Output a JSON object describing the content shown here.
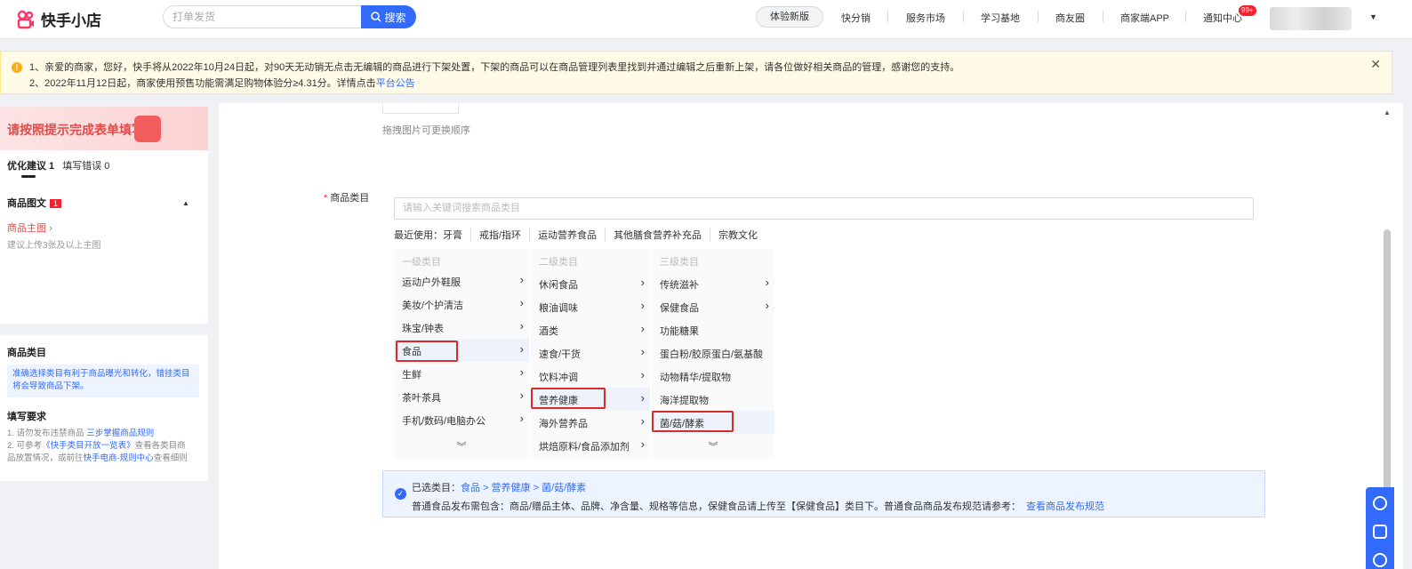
{
  "header": {
    "logo_text": "快手小店",
    "search_placeholder": "打单发货",
    "search_button": "搜索",
    "nav_pill": "体验新版",
    "nav_items": [
      "快分销",
      "服务市场",
      "学习基地",
      "商友圈",
      "商家端APP",
      "通知中心"
    ],
    "notify_badge": "99+",
    "caret": "▼"
  },
  "notice": {
    "line1": "1、亲爱的商家，您好，快手将从2022年10月24日起，对90天无动销无点击无编辑的商品进行下架处置，下架的商品可以在商品管理列表里找到并通过编辑之后重新上架，请各位做好相关商品的管理，感谢您的支持。",
    "line2_prefix": "2、2022年11月12日起，商家使用预售功能需满足购物体验分≥4.31分。详情点击",
    "line2_link": "平台公告",
    "close": "✕"
  },
  "sidebar": {
    "banner_text": "请按照提示完成表单填写",
    "tab_optimize": "优化建议 1",
    "tab_errors": "填写错误 0",
    "section_title": "商品图文",
    "section_count": "1",
    "link_main_image": "商品主图",
    "hint_main_image": "建议上传3张及以上主图",
    "cat_title": "商品类目",
    "cat_info": "准确选择类目有利于商品曝光和转化，错挂类目将会导致商品下架。",
    "req_title": "填写要求",
    "req_line1_prefix": "1. 请勿发布违禁商品",
    "req_line1_link": "三步掌握商品规则",
    "req_line2_prefix": "2. 可参考",
    "req_line2_link": "《快手类目开放一览表》",
    "req_line2_suffix": "查看各类目商",
    "req_line3_prefix": "品放置情况，或前往",
    "req_line3_link": "快手电商-规则中心",
    "req_line3_suffix": "查看细则"
  },
  "main": {
    "drag_hint": "拖拽图片可更换顺序",
    "field_label": "商品类目",
    "category_search_placeholder": "请输入关键词搜索商品类目",
    "recent_label": "最近使用：",
    "recent_items": [
      "牙膏",
      "戒指/指环",
      "运动营养食品",
      "其他膳食营养补充品",
      "宗教文化"
    ],
    "level1_head": "一级类目",
    "level1": [
      "运动户外鞋服",
      "美妆/个护清洁",
      "珠宝/钟表",
      "食品",
      "生鲜",
      "茶叶茶具",
      "手机/数码/电脑办公"
    ],
    "level2_head": "二级类目",
    "level2": [
      "休闲食品",
      "粮油调味",
      "酒类",
      "速食/干货",
      "饮料冲调",
      "营养健康",
      "海外营养品",
      "烘焙原料/食品添加剂"
    ],
    "level3_head": "三级类目",
    "level3": [
      "传统滋补",
      "保健食品",
      "功能糖果",
      "蛋白粉/胶原蛋白/氨基酸",
      "动物精华/提取物",
      "海洋提取物",
      "菌/菇/酵素"
    ],
    "more_arrow": "︾",
    "selected_label": "已选类目：",
    "selected_path": "食品 > 营养健康 > 菌/菇/酵素",
    "selected_note": "普通食品发布需包含：商品/赠品主体、品牌、净含量、规格等信息，保健食品请上传至【保健食品】类目下。普通食品商品发布规范请参考：",
    "selected_link": "查看商品发布规范"
  }
}
